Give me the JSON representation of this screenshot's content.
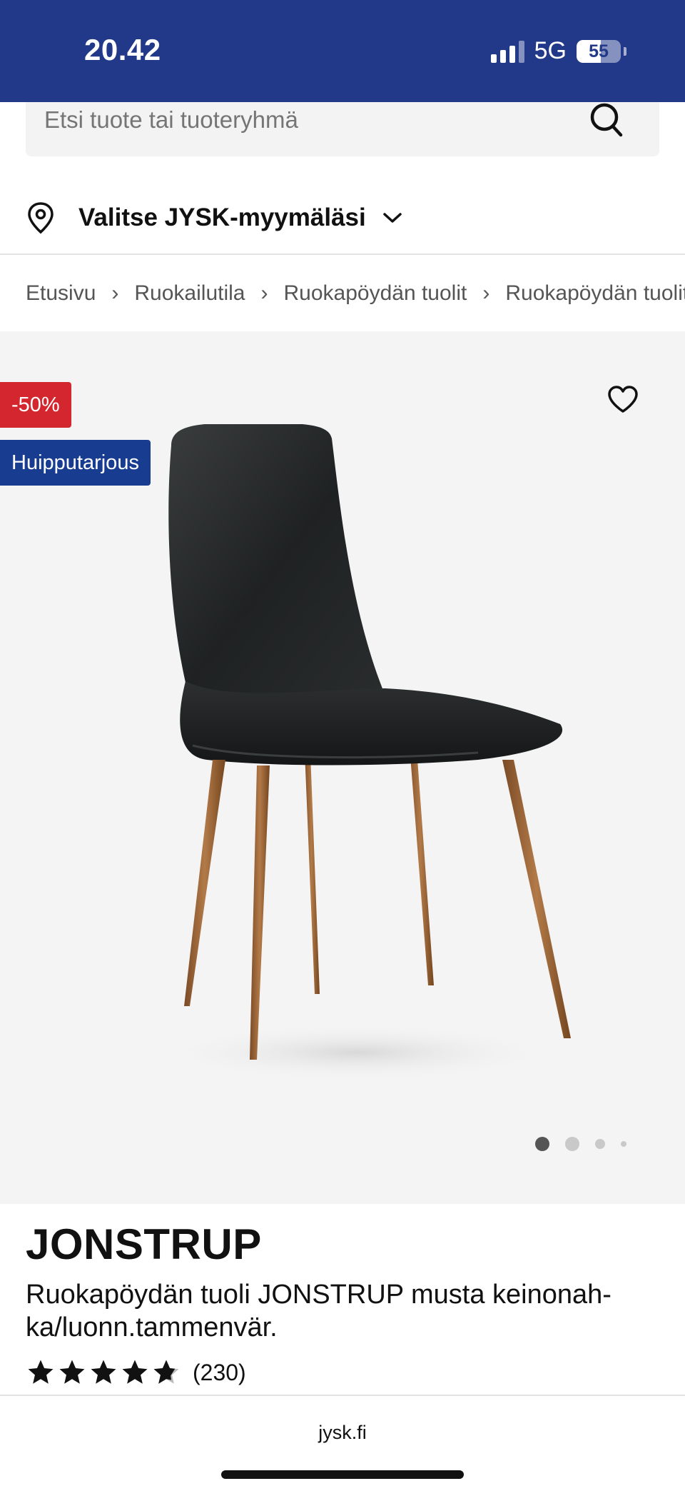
{
  "status_bar": {
    "time": "20.42",
    "network": "5G",
    "battery": "55",
    "battery_level_percent": 55
  },
  "search": {
    "placeholder": "Etsi tuote tai tuoteryhmä"
  },
  "store": {
    "label": "Valitse JYSK-myymäläsi"
  },
  "breadcrumb": {
    "items": [
      "Etusivu",
      "Ruokailutila",
      "Ruokapöydän tuolit",
      "Ruokapöydän tuolit"
    ],
    "separator": "›"
  },
  "badges": {
    "discount": "-50%",
    "deal": "Huipputarjous"
  },
  "gallery": {
    "image_count": 4,
    "active_index": 0
  },
  "product": {
    "name": "JONSTRUP",
    "description": "Ruokapöydän tuoli JONSTRUP musta keinonah-ka/luonn.tammenvär.",
    "rating": 4.5,
    "rating_max": 5,
    "review_count": "(230)"
  },
  "browser": {
    "url": "jysk.fi"
  },
  "colors": {
    "brand_blue": "#22398a",
    "discount_red": "#d4262f",
    "deal_blue": "#183c8f"
  }
}
